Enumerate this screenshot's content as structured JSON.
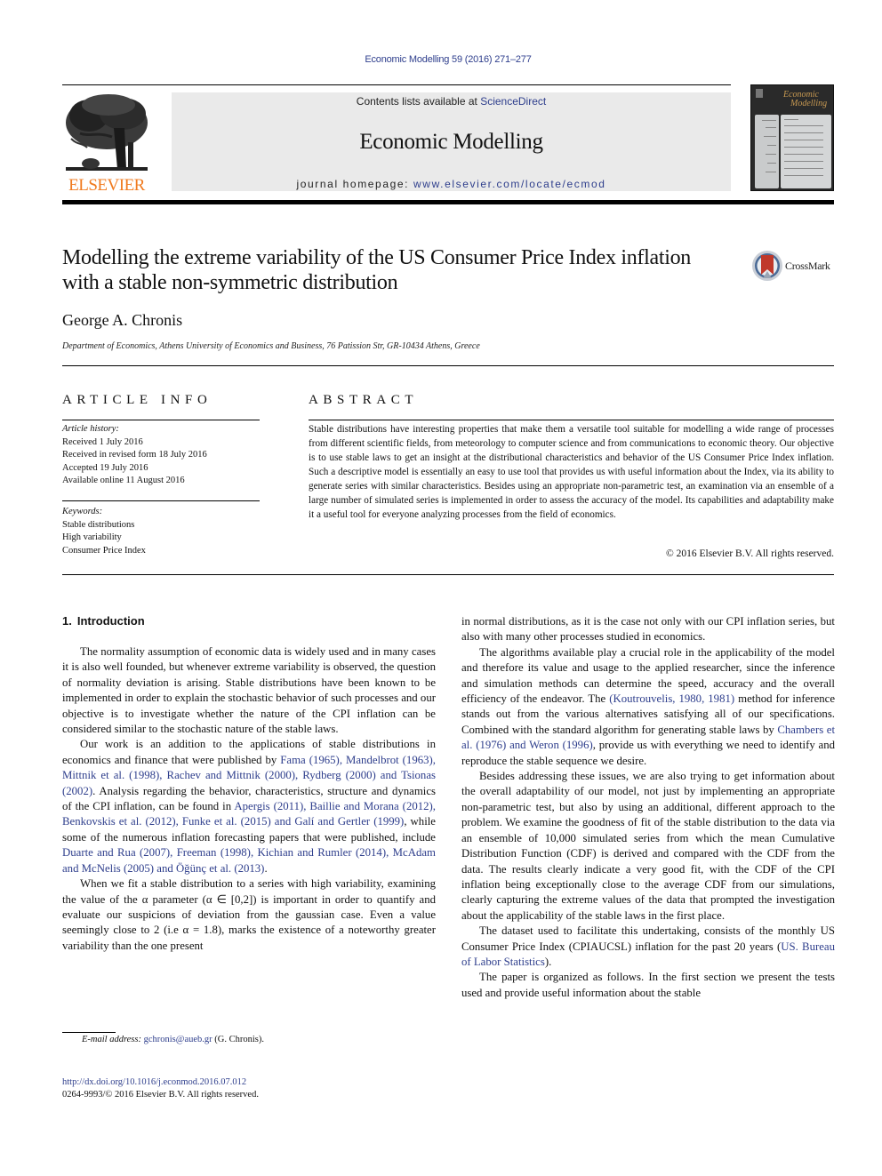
{
  "journal_ref": "Economic Modelling 59 (2016) 271–277",
  "publisher": {
    "logo_word": "ELSEVIER"
  },
  "banner": {
    "contents_prefix": "Contents lists available at ",
    "contents_link": "ScienceDirect",
    "journal_title": "Economic Modelling",
    "homepage_prefix": "journal homepage: ",
    "homepage_link": "www.elsevier.com/locate/ecmod"
  },
  "cover": {
    "title_line1": "Economic",
    "title_line2": "Modelling"
  },
  "article": {
    "title": "Modelling the extreme variability of the US Consumer Price Index inflation with a stable non-symmetric distribution",
    "author": "George A. Chronis",
    "affiliation": "Department of Economics, Athens University of Economics and Business, 76 Patission Str, GR-10434 Athens, Greece",
    "crossmark_label": "CrossMark"
  },
  "article_info": {
    "heading": "ARTICLE INFO",
    "history_label": "Article history:",
    "history": [
      "Received 1 July 2016",
      "Received in revised form 18 July 2016",
      "Accepted 19 July 2016",
      "Available online 11 August 2016"
    ],
    "keywords_label": "Keywords:",
    "keywords": [
      "Stable distributions",
      "High variability",
      "Consumer Price Index"
    ]
  },
  "abstract": {
    "heading": "ABSTRACT",
    "text": "Stable distributions have interesting properties that make them a versatile tool suitable for modelling a wide range of processes from different scientific fields, from meteorology to computer science and from communications to economic theory. Our objective is to use stable laws to get an insight at the distributional characteristics and behavior of the US Consumer Price Index inflation. Such a descriptive model is essentially an easy to use tool that provides us with useful information about the Index, via its ability to generate series with similar characteristics. Besides using an appropriate non-parametric test, an examination via an ensemble of a large number of simulated series is implemented in order to assess the accuracy of the model. Its capabilities and adaptability make it a useful tool for everyone analyzing processes from the field of economics.",
    "copyright": "© 2016 Elsevier B.V. All rights reserved."
  },
  "section1": {
    "number": "1.",
    "title": "Introduction",
    "p1": "The normality assumption of economic data is widely used and in many cases it is also well founded, but whenever extreme variability is observed, the question of normality deviation is arising. Stable distributions have been known to be implemented in order to explain the stochastic behavior of such processes and our objective is to investigate whether the nature of the CPI inflation can be considered similar to the stochastic nature of the stable laws.",
    "p2": {
      "t1": "Our work is an addition to the applications of stable distributions in economics and finance that were published by ",
      "l1": "Fama (1965), Mandelbrot (1963), Mittnik et al. (1998), Rachev and Mittnik (2000), Rydberg (2000) and Tsionas (2002)",
      "t2": ". Analysis regarding the behavior, characteristics, structure and dynamics of the CPI inflation, can be found in ",
      "l2": "Apergis (2011), Baillie and Morana (2012), Benkovskis et al. (2012), Funke et al. (2015) and Galí and Gertler (1999)",
      "t3": ", while some of the numerous inflation forecasting papers that were published, include ",
      "l3": "Duarte and Rua (2007), Freeman (1998), Kichian and Rumler (2014), McAdam and McNelis (2005) and Öğünç et al. (2013)",
      "t4": "."
    },
    "p3": "When we fit a stable distribution to a series with high variability, examining the value of the α parameter (α ∈ [0,2]) is important in order to quantify and evaluate our suspicions of deviation from the gaussian case. Even a value seemingly close to 2 (i.e α = 1.8), marks the existence of a noteworthy greater variability than the one present",
    "p3_cont": "in normal distributions, as it is the case not only with our CPI inflation series, but also with many other processes studied in economics.",
    "p4": {
      "t1": "The algorithms available play a crucial role in the applicability of the model and therefore its value and usage to the applied researcher, since the inference and simulation methods can determine the speed, accuracy and the overall efficiency of the endeavor. The ",
      "l1": "(Koutrouvelis, 1980, 1981)",
      "t2": " method for inference stands out from the various alternatives satisfying all of our specifications. Combined with the standard algorithm for generating stable laws by ",
      "l2": "Chambers et al. (1976) and Weron (1996)",
      "t3": ", provide us with everything we need to identify and reproduce the stable sequence we desire."
    },
    "p5": "Besides addressing these issues, we are also trying to get information about the overall adaptability of our model, not just by implementing an appropriate non-parametric test, but also by using an additional, different approach to the problem. We examine the goodness of fit of the stable distribution to the data via an ensemble of 10,000 simulated series from which the mean Cumulative Distribution Function (CDF) is derived and compared with the CDF from the data. The results clearly indicate a very good fit, with the CDF of the CPI inflation being exceptionally close to the average CDF from our simulations, clearly capturing the extreme values of the data that prompted the investigation about the applicability of the stable laws in the first place.",
    "p6": {
      "t1": "The dataset used to facilitate this undertaking, consists of the monthly US Consumer Price Index (CPIAUCSL) inflation for the past 20 years (",
      "l1": "US. Bureau of Labor Statistics",
      "t2": ")."
    },
    "p7": "The paper is organized as follows. In the first section we present the tests used and provide useful information about the stable"
  },
  "footnote": {
    "label": "E-mail address:",
    "email": "gchronis@aueb.gr",
    "suffix": " (G. Chronis)."
  },
  "doi": "http://dx.doi.org/10.1016/j.econmod.2016.07.012",
  "issn_line": "0264-9993/© 2016 Elsevier B.V. All rights reserved.",
  "colors": {
    "link": "#2e3e8c",
    "elsevier_orange": "#f07a1e",
    "banner_bg": "#eaeaea"
  }
}
